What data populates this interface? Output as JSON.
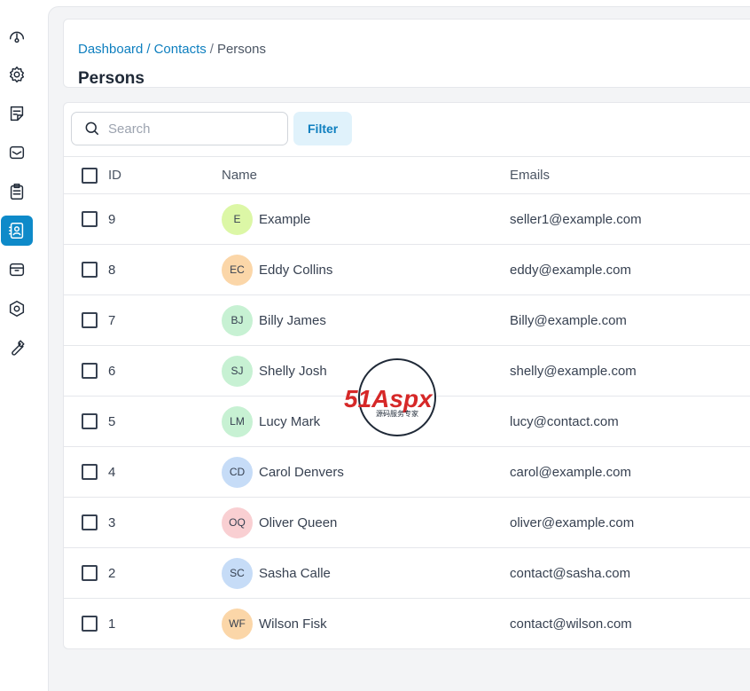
{
  "sidebar": {
    "items": [
      {
        "icon": "gauge-icon",
        "name": "sidebar-item-dashboard"
      },
      {
        "icon": "settings-cog-icon",
        "name": "sidebar-item-settings"
      },
      {
        "icon": "sticky-note-icon",
        "name": "sidebar-item-notes"
      },
      {
        "icon": "mail-icon",
        "name": "sidebar-item-mail"
      },
      {
        "icon": "clipboard-icon",
        "name": "sidebar-item-tasks"
      },
      {
        "icon": "contacts-icon",
        "name": "sidebar-item-contacts",
        "active": true
      },
      {
        "icon": "archive-icon",
        "name": "sidebar-item-archive"
      },
      {
        "icon": "hexagon-settings-icon",
        "name": "sidebar-item-configuration"
      },
      {
        "icon": "wrench-icon",
        "name": "sidebar-item-tools"
      }
    ],
    "accent_color": "#0e8ac9"
  },
  "breadcrumb": {
    "dashboard": "Dashboard",
    "contacts": "Contacts",
    "current": "Persons",
    "separator": "/"
  },
  "page_title": "Persons",
  "toolbar": {
    "search_placeholder": "Search",
    "filter_label": "Filter"
  },
  "table": {
    "columns": {
      "id": "ID",
      "name": "Name",
      "emails": "Emails"
    },
    "rows": [
      {
        "id": "9",
        "initials": "E",
        "name": "Example",
        "email": "seller1@example.com",
        "avatar_color": "#dcf7a6"
      },
      {
        "id": "8",
        "initials": "EC",
        "name": "Eddy Collins",
        "email": "eddy@example.com",
        "avatar_color": "#fbd6a8"
      },
      {
        "id": "7",
        "initials": "BJ",
        "name": "Billy James",
        "email": "Billy@example.com",
        "avatar_color": "#c7f1d3"
      },
      {
        "id": "6",
        "initials": "SJ",
        "name": "Shelly Josh",
        "email": "shelly@example.com",
        "avatar_color": "#c7f1d3"
      },
      {
        "id": "5",
        "initials": "LM",
        "name": "Lucy Mark",
        "email": "lucy@contact.com",
        "avatar_color": "#c7f1d3"
      },
      {
        "id": "4",
        "initials": "CD",
        "name": "Carol Denvers",
        "email": "carol@example.com",
        "avatar_color": "#c6dcf7"
      },
      {
        "id": "3",
        "initials": "OQ",
        "name": "Oliver Queen",
        "email": "oliver@example.com",
        "avatar_color": "#f9cfd2"
      },
      {
        "id": "2",
        "initials": "SC",
        "name": "Sasha Calle",
        "email": "contact@sasha.com",
        "avatar_color": "#c6dcf7"
      },
      {
        "id": "1",
        "initials": "WF",
        "name": "Wilson Fisk",
        "email": "contact@wilson.com",
        "avatar_color": "#fbd6a8"
      }
    ]
  },
  "watermark": {
    "logo_text": "51Aspx",
    "tagline": "源码服务专家"
  }
}
